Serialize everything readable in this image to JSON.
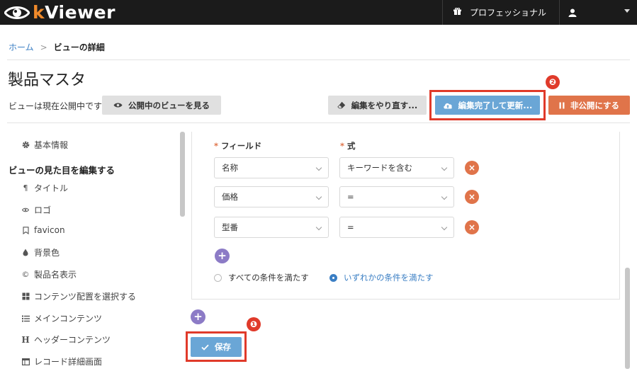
{
  "app": {
    "logo_prefix": "k",
    "logo_rest": "Viewer"
  },
  "header": {
    "plan_label": "プロフェッショナル"
  },
  "breadcrumb": {
    "home": "ホーム",
    "separator": ">",
    "current": "ビューの詳細"
  },
  "page": {
    "title": "製品マスタ",
    "status_text": "ビューは現在公開中です"
  },
  "toolbar": {
    "view_public_label": "公開中のビューを見る",
    "redo_label": "編集をやり直す...",
    "finish_label": "編集完了して更新...",
    "unpublish_label": "非公開にする"
  },
  "annotations": {
    "badge_1": "❶",
    "badge_2": "❷"
  },
  "sidebar": {
    "basic_info": "基本情報",
    "section_heading": "ビューの見た目を編集する",
    "items": [
      {
        "icon": "paragraph-icon",
        "label": "タイトル"
      },
      {
        "icon": "eye-icon",
        "label": "ロゴ"
      },
      {
        "icon": "bookmark-icon",
        "label": "favicon"
      },
      {
        "icon": "droplet-icon",
        "label": "背景色"
      },
      {
        "icon": "copyright-icon",
        "label": "製品名表示"
      },
      {
        "icon": "grid-icon",
        "label": "コンテンツ配置を選択する"
      },
      {
        "icon": "list-icon",
        "label": "メインコンテンツ"
      },
      {
        "icon": "header-icon",
        "label": "ヘッダーコンテンツ"
      },
      {
        "icon": "window-icon",
        "label": "レコード詳細画面"
      }
    ]
  },
  "filter": {
    "field_label": "フィールド",
    "expr_label": "式",
    "required_mark": "*",
    "rows": [
      {
        "field": "名称",
        "expr": "キーワードを含む"
      },
      {
        "field": "価格",
        "expr": "="
      },
      {
        "field": "型番",
        "expr": "="
      }
    ],
    "delete_symbol": "×",
    "add_symbol": "+",
    "match_all": "すべての条件を満たす",
    "match_any": "いずれかの条件を満たす",
    "selected_match": "any"
  },
  "footer": {
    "save_label": "保存",
    "add_symbol": "+"
  },
  "colors": {
    "accent_blue": "#6aa6d6",
    "accent_orange": "#e0744a",
    "highlight_red": "#e03a2a",
    "add_purple": "#8c7bc6",
    "topbar": "#1b1b1b"
  }
}
